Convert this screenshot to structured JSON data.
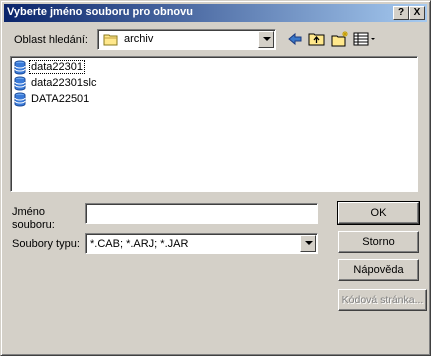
{
  "window": {
    "title": "Vyberte jméno souboru pro obnovu",
    "help_glyph": "?",
    "close_glyph": "X"
  },
  "lookin": {
    "label": "Oblast hledání:",
    "value": "archiv",
    "icon": "folder-icon"
  },
  "toolbar": {
    "back_icon": "back-arrow-icon",
    "up_icon": "folder-up-icon",
    "new_folder_icon": "new-folder-icon",
    "views_icon": "view-menu-icon"
  },
  "files": [
    {
      "name": "data22301",
      "icon": "database-file-icon"
    },
    {
      "name": "data22301slc",
      "icon": "database-file-icon"
    },
    {
      "name": "DATA22501",
      "icon": "database-file-icon"
    }
  ],
  "filename": {
    "label_line1": "Jméno",
    "label_line2": "souboru:",
    "value": ""
  },
  "filetype": {
    "label": "Soubory typu:",
    "value": "*.CAB; *.ARJ; *.JAR"
  },
  "buttons": {
    "ok": "OK",
    "cancel": "Storno",
    "help": "Nápověda",
    "codepage": "Kódová stránka..."
  }
}
